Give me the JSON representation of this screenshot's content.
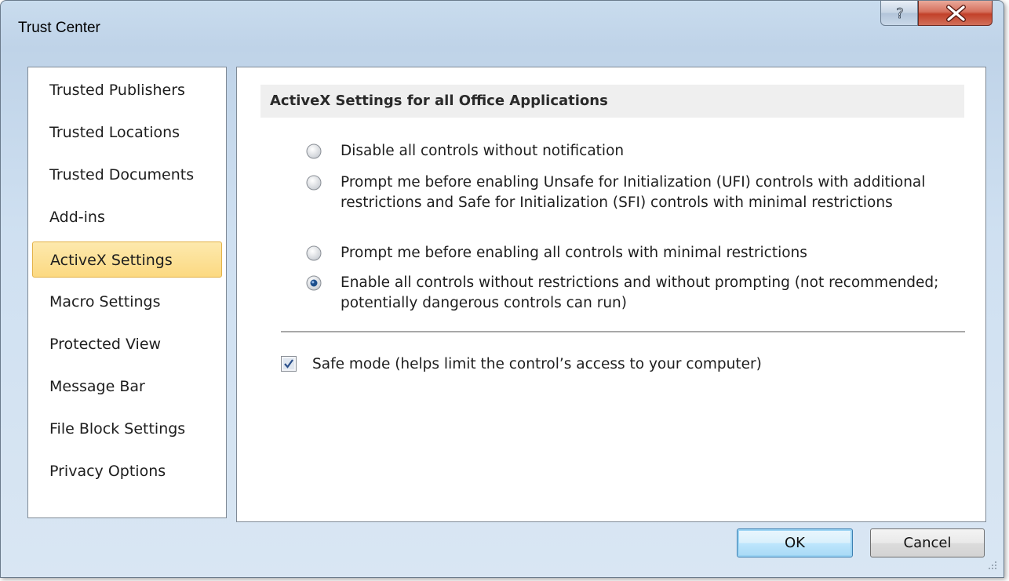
{
  "window": {
    "title": "Trust Center"
  },
  "titlebar": {
    "help_icon": "help-icon",
    "close_icon": "close-icon"
  },
  "sidebar": {
    "items": [
      {
        "label": "Trusted Publishers",
        "selected": false
      },
      {
        "label": "Trusted Locations",
        "selected": false
      },
      {
        "label": "Trusted Documents",
        "selected": false
      },
      {
        "label": "Add-ins",
        "selected": false
      },
      {
        "label": "ActiveX Settings",
        "selected": true
      },
      {
        "label": "Macro Settings",
        "selected": false
      },
      {
        "label": "Protected View",
        "selected": false
      },
      {
        "label": "Message Bar",
        "selected": false
      },
      {
        "label": "File Block Settings",
        "selected": false
      },
      {
        "label": "Privacy Options",
        "selected": false
      }
    ]
  },
  "main": {
    "section_title": "ActiveX Settings for all Office Applications",
    "options": [
      {
        "label": "Disable all controls without notification",
        "checked": false
      },
      {
        "label": "Prompt me before enabling Unsafe for Initialization (UFI) controls with additional restrictions and Safe for Initialization (SFI) controls with minimal restrictions",
        "checked": false
      },
      {
        "label": "Prompt me before enabling all controls with minimal restrictions",
        "checked": false
      },
      {
        "label": "Enable all controls without restrictions and without prompting (not recommended; potentially dangerous controls can run)",
        "checked": true
      }
    ],
    "safe_mode": {
      "label": "Safe mode (helps limit the control’s access to your computer)",
      "checked": true
    }
  },
  "footer": {
    "ok_label": "OK",
    "cancel_label": "Cancel"
  },
  "colors": {
    "selected_bg": "#fcd981",
    "selected_border": "#e3b248",
    "close_red": "#c2412a",
    "default_button_border": "#3c7fb1"
  }
}
